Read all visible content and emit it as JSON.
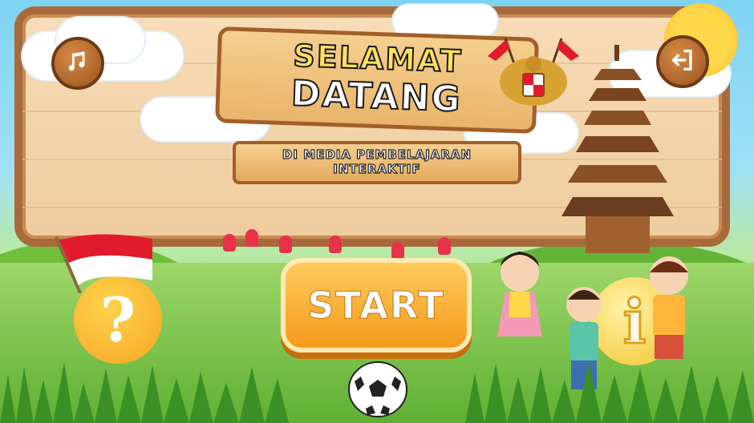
{
  "title": {
    "line1": "SELAMAT",
    "line2": "DATANG"
  },
  "subtitle": {
    "line1": "DI MEDIA PEMBELAJARAN",
    "line2": "INTERAKTIF"
  },
  "buttons": {
    "start_label": "START",
    "help_symbol": "?",
    "info_symbol": "i",
    "music_icon": "music-note-icon",
    "exit_icon": "exit-icon"
  },
  "colors": {
    "board": "#efcc9f",
    "board_border": "#a86a3a",
    "start": "#f49a1c",
    "help": "#f5a623",
    "info": "#f3c52e",
    "flag_red": "#e21b2c"
  }
}
